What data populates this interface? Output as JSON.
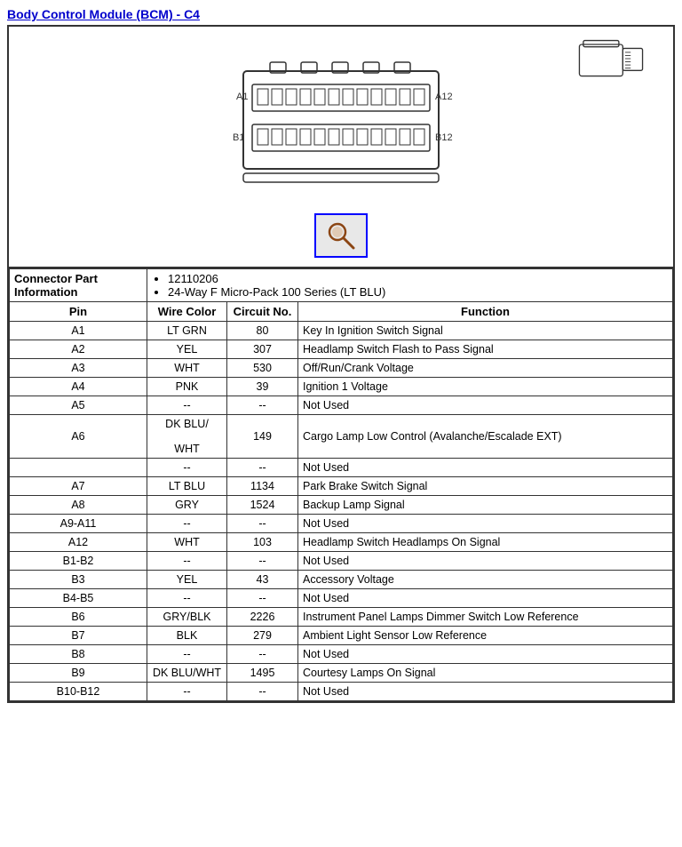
{
  "title": "Body Control Module (BCM) - C4",
  "connector_info": {
    "label": "Connector Part Information",
    "parts": [
      "12110206",
      "24-Way F Micro-Pack 100 Series (LT BLU)"
    ]
  },
  "table": {
    "headers": [
      "Pin",
      "Wire Color",
      "Circuit No.",
      "Function"
    ],
    "rows": [
      {
        "pin": "A1",
        "wire": "LT GRN",
        "circuit": "80",
        "function": "Key In Ignition Switch Signal"
      },
      {
        "pin": "A2",
        "wire": "YEL",
        "circuit": "307",
        "function": "Headlamp Switch Flash to Pass Signal"
      },
      {
        "pin": "A3",
        "wire": "WHT",
        "circuit": "530",
        "function": "Off/Run/Crank Voltage"
      },
      {
        "pin": "A4",
        "wire": "PNK",
        "circuit": "39",
        "function": "Ignition 1 Voltage"
      },
      {
        "pin": "A5",
        "wire": "--",
        "circuit": "--",
        "function": "Not Used"
      },
      {
        "pin": "A6",
        "wire": "DK BLU/\n\nWHT",
        "circuit": "149",
        "function": "Cargo Lamp Low Control (Avalanche/Escalade EXT)"
      },
      {
        "pin": "",
        "wire": "--",
        "circuit": "--",
        "function": "Not Used"
      },
      {
        "pin": "A7",
        "wire": "LT BLU",
        "circuit": "1134",
        "function": "Park Brake Switch Signal"
      },
      {
        "pin": "A8",
        "wire": "GRY",
        "circuit": "1524",
        "function": "Backup Lamp Signal"
      },
      {
        "pin": "A9-A11",
        "wire": "--",
        "circuit": "--",
        "function": "Not Used"
      },
      {
        "pin": "A12",
        "wire": "WHT",
        "circuit": "103",
        "function": "Headlamp Switch Headlamps On Signal"
      },
      {
        "pin": "B1-B2",
        "wire": "--",
        "circuit": "--",
        "function": "Not Used"
      },
      {
        "pin": "B3",
        "wire": "YEL",
        "circuit": "43",
        "function": "Accessory Voltage"
      },
      {
        "pin": "B4-B5",
        "wire": "--",
        "circuit": "--",
        "function": "Not Used"
      },
      {
        "pin": "B6",
        "wire": "GRY/BLK",
        "circuit": "2226",
        "function": "Instrument Panel Lamps Dimmer Switch Low Reference"
      },
      {
        "pin": "B7",
        "wire": "BLK",
        "circuit": "279",
        "function": "Ambient Light Sensor Low Reference"
      },
      {
        "pin": "B8",
        "wire": "--",
        "circuit": "--",
        "function": "Not Used"
      },
      {
        "pin": "B9",
        "wire": "DK BLU/WHT",
        "circuit": "1495",
        "function": "Courtesy Lamps On Signal"
      },
      {
        "pin": "B10-B12",
        "wire": "--",
        "circuit": "--",
        "function": "Not Used"
      }
    ]
  }
}
